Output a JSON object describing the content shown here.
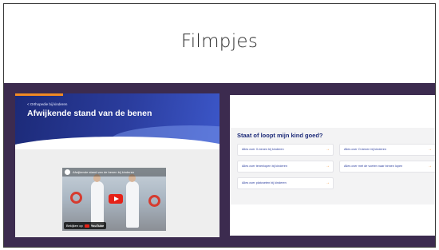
{
  "slide": {
    "title": "Filmpjes"
  },
  "left_screenshot": {
    "breadcrumb": "< Orthopedie bij kinderen",
    "heading": "Afwijkende stand van de benen",
    "video": {
      "title": "Afwijkende stand van de benen bij kinderen",
      "watch_on": "Bekijken op",
      "platform": "YouTube"
    }
  },
  "right_screenshot": {
    "heading": "Staat of loopt mijn kind goed?",
    "links": [
      {
        "label": "Alles over X-benen bij kinderen"
      },
      {
        "label": "Alles over O-benen bij kinderen"
      },
      {
        "label": "Alles over tenenlopen bij kinderen"
      },
      {
        "label": "Alles over met de voeten naar binnen lopen"
      },
      {
        "label": "Alles over platvoeten bij kinderen"
      }
    ],
    "arrow": "→"
  },
  "colors": {
    "band": "#3c2b4f",
    "hero_blue": "#2b3d9e",
    "accent_orange": "#f08a24",
    "youtube_red": "#e62117"
  }
}
